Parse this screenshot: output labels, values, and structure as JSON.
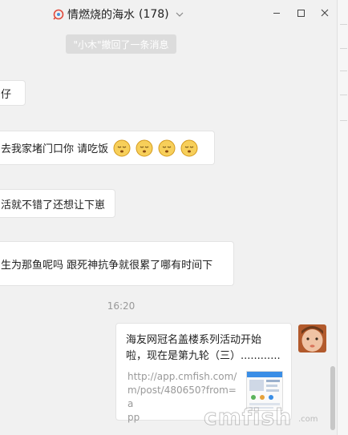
{
  "window": {
    "title": "情燃烧的海水",
    "member_count": "(178)",
    "title_icon": "chat-group-icon",
    "controls": [
      "minimize-icon",
      "maximize-icon",
      "close-icon"
    ]
  },
  "notice": {
    "actor": "\"小木\"",
    "text": " 撤回了一条消息"
  },
  "messages": [
    {
      "text": "仔"
    },
    {
      "text": "去我家堵门口你  请吃饭",
      "emoji_count": 4,
      "emoji": "sleepy-face-emoji"
    },
    {
      "text": "活就不错了还想让下崽"
    },
    {
      "text": "生为那鱼呢吗  跟死神抗争就很累了哪有时间下"
    }
  ],
  "timestamp": "16:20",
  "shared_card": {
    "title": "海友网冠名盖楼系列活动开始\n啦，现在是第九轮（三）............",
    "url": "http://app.cmfish.com/\nm/post/480650?from=a\npp",
    "thumbnail": "page-thumbnail"
  },
  "watermark": {
    "text": "cmfish",
    "domain": ".com"
  },
  "colors": {
    "background": "#f1f1f1",
    "bubble": "#ffffff",
    "notice_bg": "#dcdcdc",
    "muted_text": "#999999"
  }
}
